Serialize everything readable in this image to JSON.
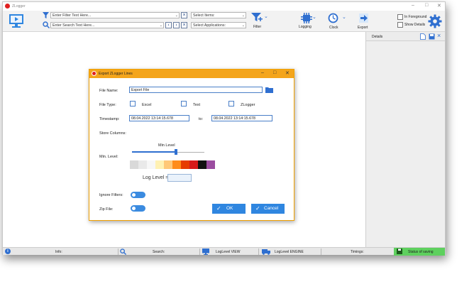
{
  "window": {
    "title": "ZLogger"
  },
  "toolbar": {
    "filter_placeholder": "Enter Filter Text Here...",
    "search_placeholder": "Enter Search Text Here...",
    "select_items": "Select Items:",
    "select_applications": "Select Applications:",
    "filter_label": "Filter",
    "logging_label": "Logging",
    "clock_label": "Clock",
    "export_label": "Export",
    "in_foreground": "In Foreground",
    "show_details": "Show Details"
  },
  "details": {
    "title": "Details"
  },
  "dialog": {
    "title": "Export ZLogger Lines",
    "file_name_label": "File Name:",
    "file_name_value": "Export File",
    "file_type_label": "File Type:",
    "file_types": [
      "Excel",
      "Text",
      "ZLogger"
    ],
    "timestamp_label": "Timestamp:",
    "timestamp_from": "08.04.2022 13:14:15.678",
    "to_label": "to:",
    "timestamp_to": "08.04.2022 13:14:15.678",
    "store_columns_label": "Store Columns:",
    "min_level_label": "Min. Level:",
    "min_level_title": "Min Level",
    "log_level_label": "Log Level =",
    "ignore_filters_label": "Ignore Filters:",
    "zip_file_label": "Zip File:",
    "ok_label": "OK",
    "cancel_label": "Cancel",
    "level_colors": [
      "#d9d9d9",
      "#e9e9e9",
      "#f7f7f7",
      "#fff1b3",
      "#ffc878",
      "#ff8c1a",
      "#e63c00",
      "#d61a1a",
      "#111111",
      "#9b4da0"
    ]
  },
  "statusbar": {
    "info_label": "Info:",
    "search_label": "Search:",
    "loglevel_view": "LogLevel VIEW",
    "loglevel_engine": "LogLevel ENGINE",
    "timings_label": "Timings:",
    "status_saving": "Status of saving"
  },
  "icons": [
    "app-logo-icon",
    "monitor-icon",
    "filter-icon",
    "search-icon",
    "chevron-left-icon",
    "chevron-right-icon",
    "close-icon",
    "logging-chip-icon",
    "clock-icon",
    "export-arrow-icon",
    "gear-icon",
    "new-file-icon",
    "save-icon",
    "folder-icon",
    "info-icon",
    "monitor-small-icon",
    "truck-icon",
    "disk-icon"
  ]
}
